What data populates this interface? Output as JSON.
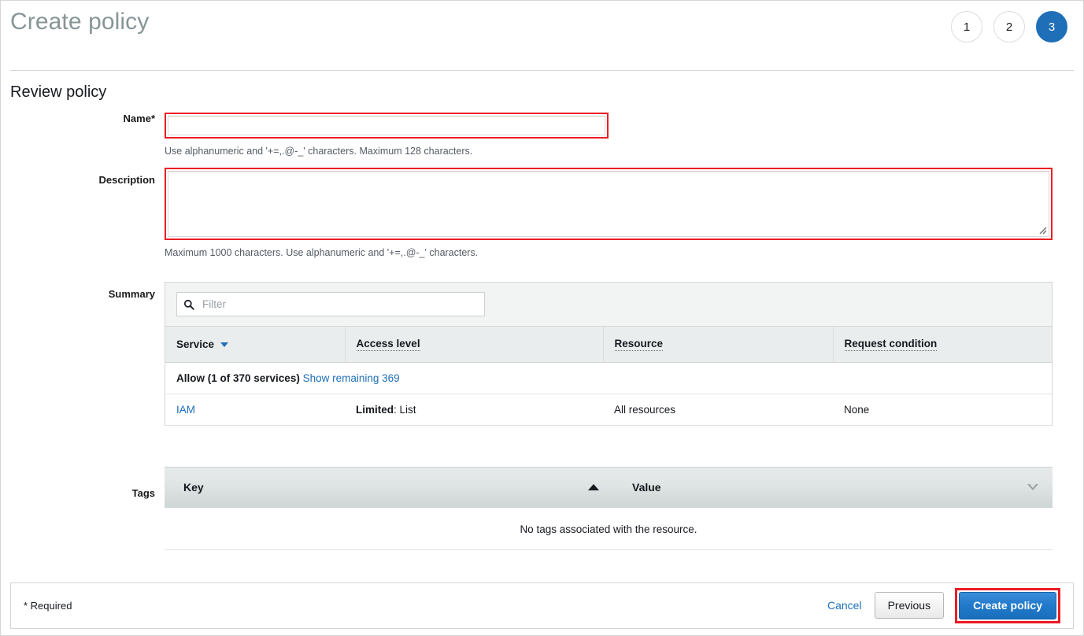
{
  "header": {
    "title": "Create policy",
    "steps": [
      {
        "label": "1",
        "active": false
      },
      {
        "label": "2",
        "active": false
      },
      {
        "label": "3",
        "active": true
      }
    ]
  },
  "review": {
    "section_title": "Review policy",
    "name": {
      "label": "Name*",
      "value": "",
      "placeholder": "",
      "helper": "Use alphanumeric and '+=,.@-_' characters. Maximum 128 characters."
    },
    "description": {
      "label": "Description",
      "value": "",
      "placeholder": "",
      "helper": "Maximum 1000 characters. Use alphanumeric and '+=,.@-_' characters."
    }
  },
  "summary": {
    "label": "Summary",
    "filter_placeholder": "Filter",
    "filter_value": "",
    "columns": [
      {
        "label": "Service",
        "sorted": true
      },
      {
        "label": "Access level",
        "sorted": false
      },
      {
        "label": "Resource",
        "sorted": false
      },
      {
        "label": "Request condition",
        "sorted": false
      }
    ],
    "group_row": {
      "text": "Allow (1 of 370 services)",
      "link": "Show remaining 369"
    },
    "rows": [
      {
        "service": "IAM",
        "access_level_strong": "Limited",
        "access_level_rest": ": List",
        "resource": "All resources",
        "request_condition": "None"
      }
    ]
  },
  "tags": {
    "label": "Tags",
    "columns": [
      {
        "label": "Key",
        "sort": "asc"
      },
      {
        "label": "Value",
        "sort": "none"
      }
    ],
    "empty_text": "No tags associated with the resource."
  },
  "footer": {
    "required_note": "* Required",
    "cancel_label": "Cancel",
    "previous_label": "Previous",
    "create_label": "Create policy"
  },
  "colors": {
    "accent_blue": "#1f6fb8",
    "highlight_red": "#ec1c24",
    "title_gray": "#879596",
    "header_bg": "#eaeded"
  }
}
